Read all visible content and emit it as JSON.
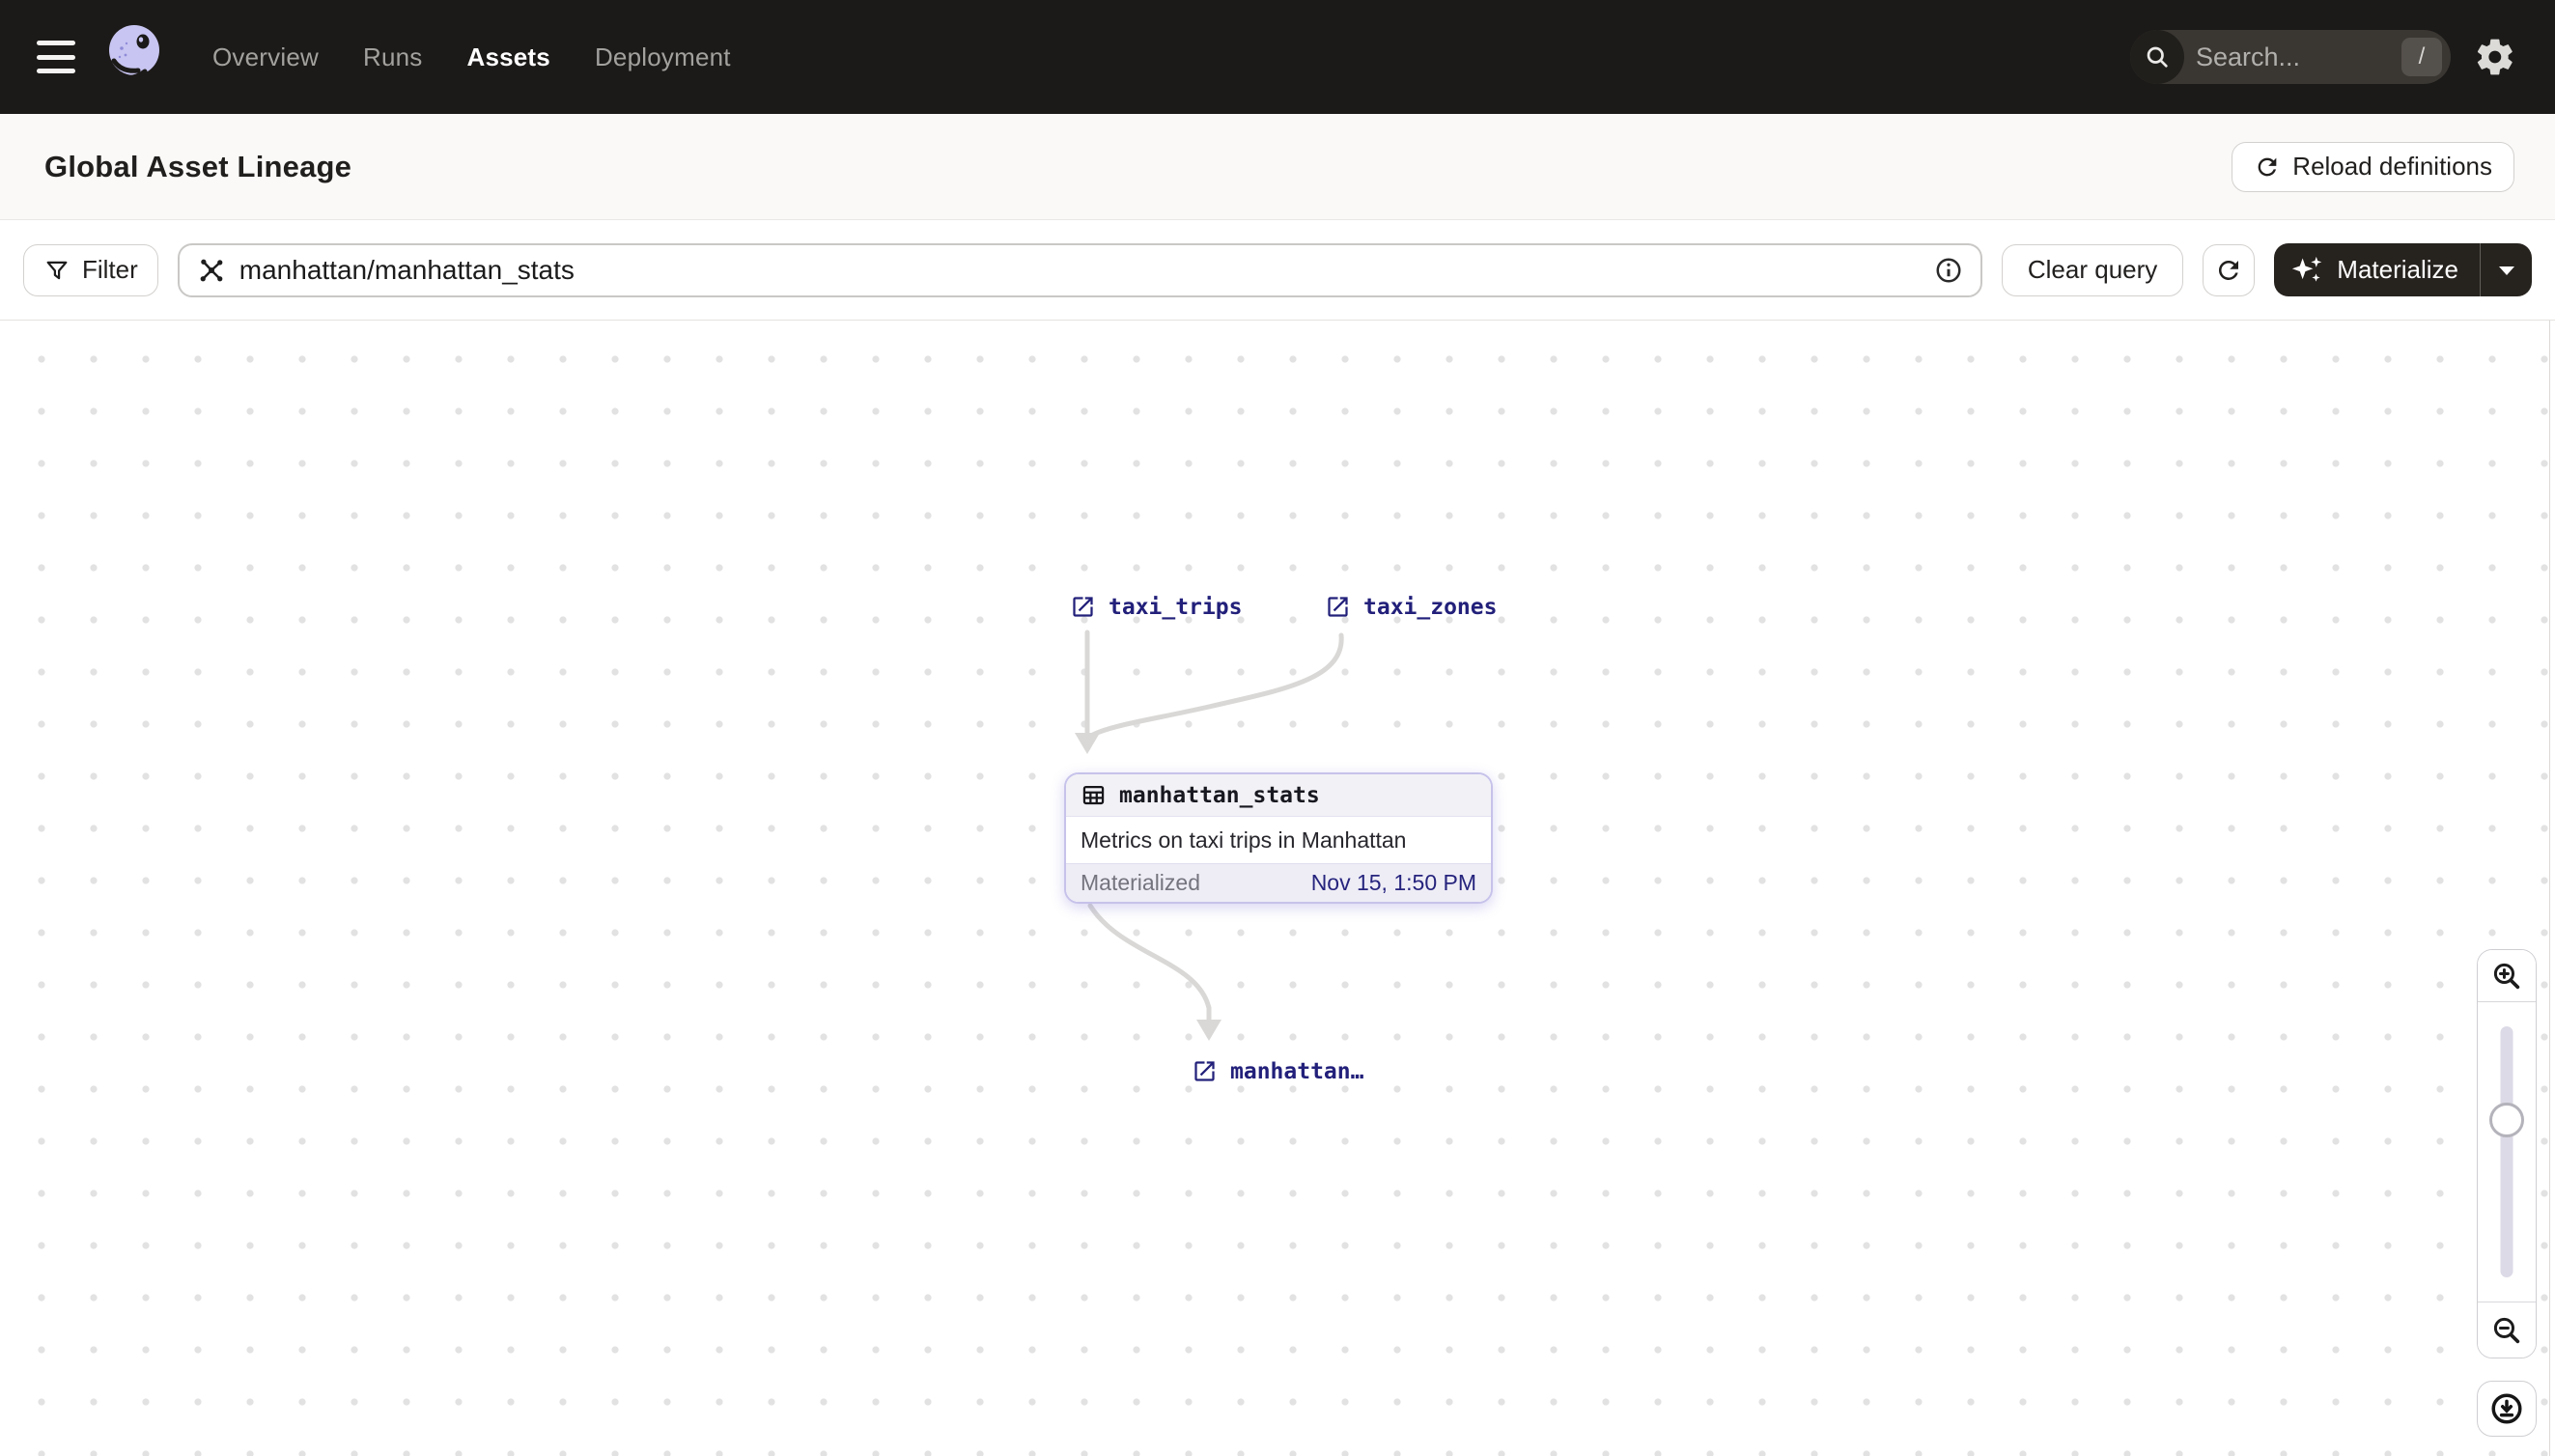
{
  "nav": {
    "items": [
      {
        "label": "Overview",
        "active": false
      },
      {
        "label": "Runs",
        "active": false
      },
      {
        "label": "Assets",
        "active": true
      },
      {
        "label": "Deployment",
        "active": false
      }
    ],
    "search": {
      "placeholder": "Search...",
      "shortcut": "/"
    }
  },
  "header": {
    "title": "Global Asset Lineage",
    "reload_button": "Reload definitions"
  },
  "toolbar": {
    "filter_button": "Filter",
    "query_input": "manhattan/manhattan_stats",
    "clear_button": "Clear query",
    "materialize_button": "Materialize"
  },
  "graph": {
    "upstream_nodes": [
      {
        "name": "taxi_trips"
      },
      {
        "name": "taxi_zones"
      }
    ],
    "asset_card": {
      "name": "manhattan_stats",
      "description": "Metrics on taxi trips in Manhattan",
      "status": "Materialized",
      "last_materialized": "Nov 15, 1:50 PM"
    },
    "downstream_nodes": [
      {
        "name": "manhattan…"
      }
    ]
  },
  "colors": {
    "nav_background": "#1c1a18",
    "link_navy": "#22207a",
    "card_border": "#c6c2ea",
    "edge_gray": "#d9d8d6",
    "logo_lavender": "#c8c5f2"
  }
}
